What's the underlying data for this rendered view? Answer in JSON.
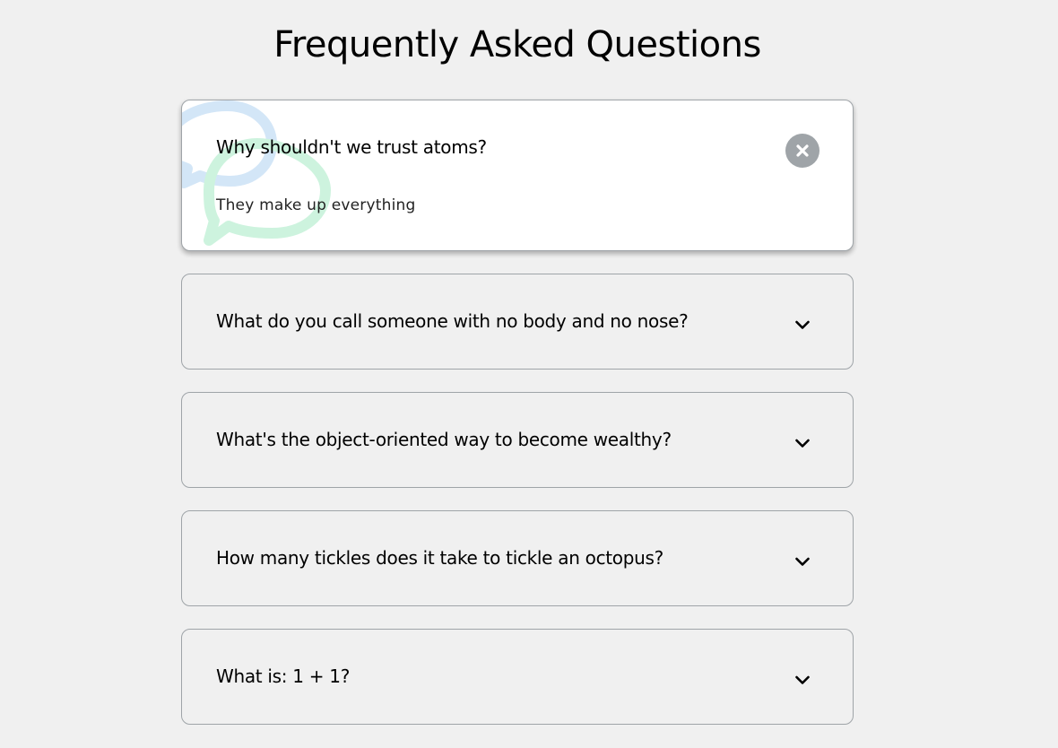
{
  "page": {
    "title": "Frequently Asked Questions"
  },
  "faqs": [
    {
      "question": "Why shouldn't we trust atoms?",
      "answer": "They make up everything",
      "expanded": true,
      "toggle_icon": "close-icon"
    },
    {
      "question": "What do you call someone with no body and no nose?",
      "expanded": false,
      "toggle_icon": "chevron-down-icon"
    },
    {
      "question": "What's the object-oriented way to become wealthy?",
      "expanded": false,
      "toggle_icon": "chevron-down-icon"
    },
    {
      "question": "How many tickles does it take to tickle an octopus?",
      "expanded": false,
      "toggle_icon": "chevron-down-icon"
    },
    {
      "question": "What is: 1 + 1?",
      "expanded": false,
      "toggle_icon": "chevron-down-icon"
    }
  ],
  "colors": {
    "background": "#f0f0f0",
    "card_active": "#ffffff",
    "border": "#9fa4a8",
    "deco_blue": "#d3e6f7",
    "deco_green": "#cdf3de"
  }
}
